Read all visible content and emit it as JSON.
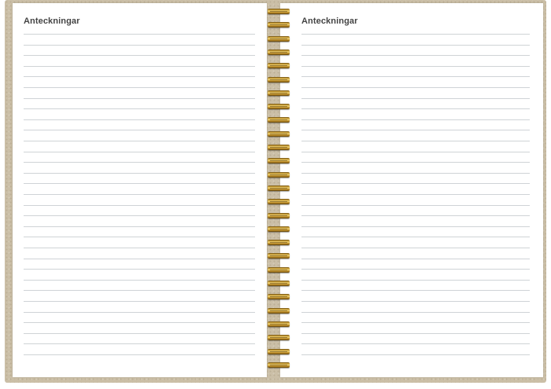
{
  "notebook": {
    "left_page": {
      "title": "Anteckningar"
    },
    "right_page": {
      "title": "Anteckningar"
    }
  }
}
